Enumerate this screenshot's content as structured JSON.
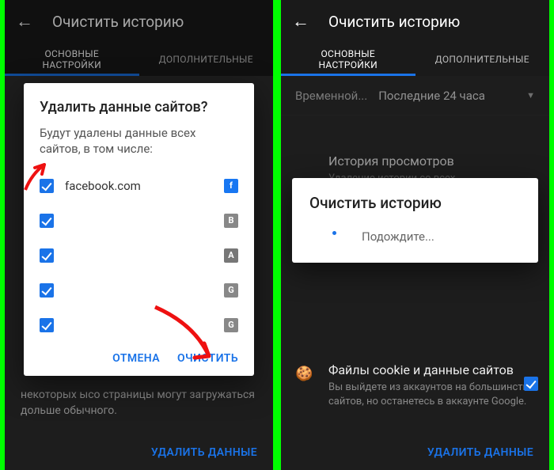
{
  "left": {
    "toolbar": {
      "title": "Очистить историю"
    },
    "tabs": {
      "active": "ОСНОВНЫЕ\nНАСТРОЙКИ",
      "inactive": "ДОПОЛНИТЕЛЬНЫЕ"
    },
    "dialog": {
      "title": "Удалить данные сайтов?",
      "desc": "Будут удалены данные всех сайтов, в том числе:",
      "sites": {
        "s0": {
          "label": "facebook.com",
          "icon": "f"
        },
        "s1": {
          "label": "",
          "icon": "B"
        },
        "s2": {
          "label": "",
          "icon": "A"
        },
        "s3": {
          "label": "",
          "icon": "G"
        },
        "s4": {
          "label": "",
          "icon": "G"
        }
      },
      "cancel": "ОТМЕНА",
      "confirm": "ОЧИСТИТЬ"
    },
    "bgtext": "некоторых ысо страницы могут загружаться дольше обычного.",
    "bottom_button": "УДАЛИТЬ ДАННЫЕ"
  },
  "right": {
    "toolbar": {
      "title": "Очистить историю"
    },
    "tabs": {
      "active": "ОСНОВНЫЕ\nНАСТРОЙКИ",
      "inactive": "ДОПОЛНИТЕЛЬНЫЕ"
    },
    "time": {
      "label": "Временной...",
      "value": "Последние 24 часа"
    },
    "history": {
      "title": "История просмотров",
      "sub": "Удаление истории со всех"
    },
    "cookies": {
      "title": "Файлы cookie и данные сайтов",
      "sub": "Вы выйдете из аккаунтов на большинстве сайтов, но останетесь в аккаунте Google."
    },
    "dialog": {
      "title": "Очистить историю",
      "wait": "Подождите..."
    },
    "bottom_button": "УДАЛИТЬ ДАННЫЕ"
  }
}
